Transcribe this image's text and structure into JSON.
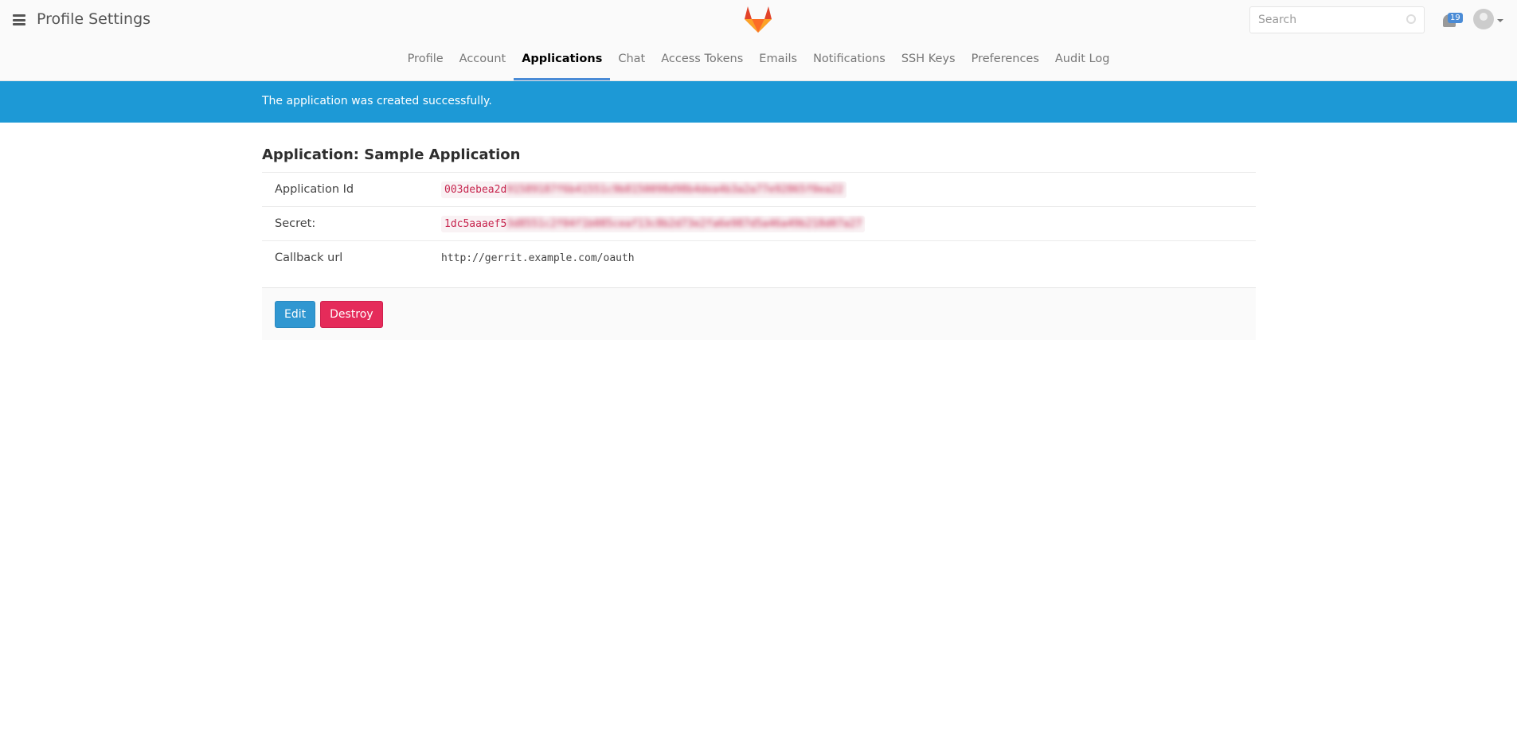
{
  "header": {
    "title": "Profile Settings",
    "search_placeholder": "Search",
    "notification_count": "19"
  },
  "tabs": [
    {
      "label": "Profile"
    },
    {
      "label": "Account"
    },
    {
      "label": "Applications",
      "active": true
    },
    {
      "label": "Chat"
    },
    {
      "label": "Access Tokens"
    },
    {
      "label": "Emails"
    },
    {
      "label": "Notifications"
    },
    {
      "label": "SSH Keys"
    },
    {
      "label": "Preferences"
    },
    {
      "label": "Audit Log"
    }
  ],
  "flash": "The application was created successfully.",
  "application": {
    "heading": "Application: Sample Application",
    "rows": [
      {
        "label": "Application Id",
        "value_visible": "003debea2d",
        "value_hidden": "91589187f6b41551c9b8150098d98b4dea4b3a2a77e92865f0ea22"
      },
      {
        "label": "Secret:",
        "value_visible": "1dc5aaaef5",
        "value_hidden": "3d8551c2f04f1b085ceaf13c8b2d73e2fa6e987d5a46a49b218d07a27"
      },
      {
        "label": "Callback url",
        "value": "http://gerrit.example.com/oauth"
      }
    ],
    "edit_label": "Edit",
    "destroy_label": "Destroy"
  },
  "colors": {
    "accent": "#1d99d6",
    "destroy": "#e52b5a",
    "edit": "#3097d1"
  }
}
